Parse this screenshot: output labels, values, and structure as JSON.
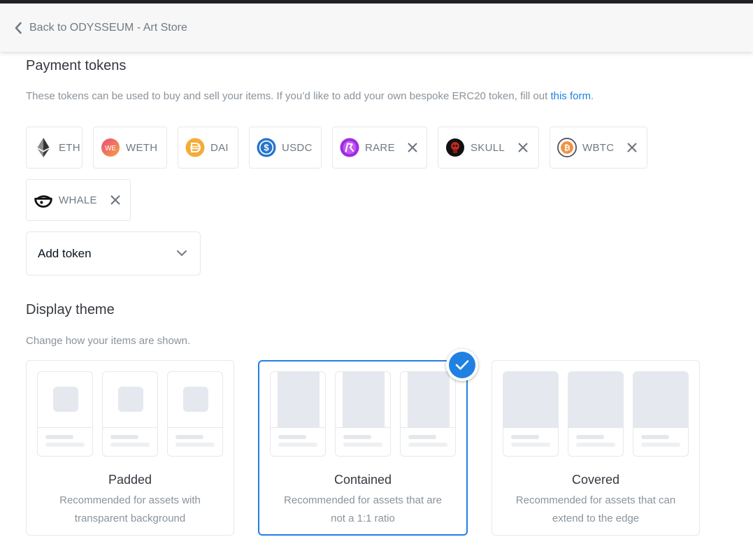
{
  "header": {
    "back_label": "Back to ODYSSEUM - Art Store"
  },
  "payment": {
    "title": "Payment tokens",
    "description_prefix": "These tokens can be used to buy and sell your items. If you’d like to add your own bespoke ERC20 token, fill out ",
    "link_text": "this form",
    "description_suffix": ".",
    "tokens": [
      {
        "symbol": "ETH",
        "removable": false,
        "icon": "ethereum-icon"
      },
      {
        "symbol": "WETH",
        "removable": false,
        "icon": "weth-icon"
      },
      {
        "symbol": "DAI",
        "removable": false,
        "icon": "dai-icon"
      },
      {
        "symbol": "USDC",
        "removable": false,
        "icon": "usdc-icon"
      },
      {
        "symbol": "RARE",
        "removable": true,
        "icon": "rare-icon"
      },
      {
        "symbol": "SKULL",
        "removable": true,
        "icon": "skull-icon"
      },
      {
        "symbol": "WBTC",
        "removable": true,
        "icon": "wbtc-icon"
      },
      {
        "symbol": "WHALE",
        "removable": true,
        "icon": "whale-icon"
      }
    ],
    "add_token_label": "Add token"
  },
  "display_theme": {
    "title": "Display theme",
    "description": "Change how your items are shown.",
    "selected": "Contained",
    "options": [
      {
        "title": "Padded",
        "description": "Recommended for assets with transparent background"
      },
      {
        "title": "Contained",
        "description": "Recommended for assets that are not a 1:1 ratio"
      },
      {
        "title": "Covered",
        "description": "Recommended for assets that can extend to the edge"
      }
    ]
  },
  "colors": {
    "accent": "#2081e2",
    "border": "#e5e8eb",
    "muted_text": "#8a939b"
  }
}
